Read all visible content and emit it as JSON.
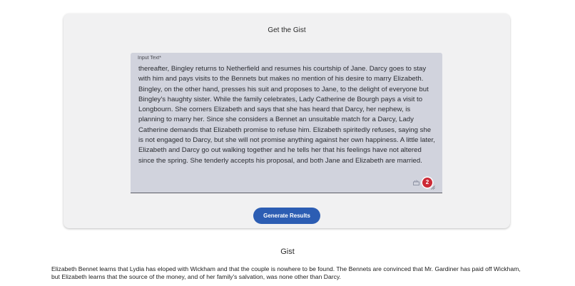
{
  "card": {
    "title": "Get the Gist"
  },
  "input": {
    "label": "Input Text*",
    "value": "thereafter, Bingley returns to Netherfield and resumes his courtship of Jane. Darcy goes to stay with him and pays visits to the Bennets but makes no mention of his desire to marry Elizabeth. Bingley, on the other hand, presses his suit and proposes to Jane, to the delight of everyone but Bingley's haughty sister. While the family celebrates, Lady Catherine de Bourgh pays a visit to Longbourn. She corners Elizabeth and says that she has heard that Darcy, her nephew, is planning to marry her. Since she considers a Bennet an unsuitable match for a Darcy, Lady Catherine demands that Elizabeth promise to refuse him. Elizabeth spiritedly refuses, saying she is not engaged to Darcy, but she will not promise anything against her own happiness. A little later, Elizabeth and Darcy go out walking together and he tells her that his feelings have not altered since the spring. She tenderly accepts his proposal, and both Jane and Elizabeth are married.",
    "grammar_badge_count": "2",
    "grammar_icon": "grammar-check-icon"
  },
  "actions": {
    "generate_label": "Generate Results"
  },
  "result": {
    "heading": "Gist",
    "text": "Elizabeth Bennet learns that Lydia has eloped with Wickham and that the couple is nowhere to be found. The Bennets are convinced that Mr. Gardiner has paid off Wickham, but Elizabeth learns that the source of the money, and of her family's salvation, was none other than Darcy."
  },
  "colors": {
    "button": "#2c5db3",
    "field_background": "#d1d3dd",
    "card_background": "#f1f1f2",
    "badge": "#cc2a36"
  }
}
